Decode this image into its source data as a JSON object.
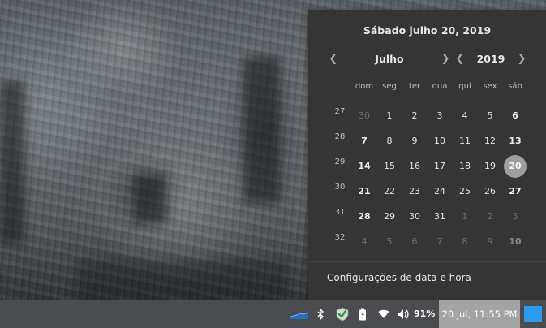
{
  "calendar": {
    "heading": "Sábado julho 20, 2019",
    "month_label": "Julho",
    "year_label": "2019",
    "weekdays": [
      "dom",
      "seg",
      "ter",
      "qua",
      "qui",
      "sex",
      "sáb"
    ],
    "week_numbers": [
      "27",
      "28",
      "29",
      "30",
      "31",
      "32"
    ],
    "weeks": [
      [
        "30",
        "1",
        "2",
        "3",
        "4",
        "5",
        "6"
      ],
      [
        "7",
        "8",
        "9",
        "10",
        "11",
        "12",
        "13"
      ],
      [
        "14",
        "15",
        "16",
        "17",
        "18",
        "19",
        "20"
      ],
      [
        "21",
        "22",
        "23",
        "24",
        "25",
        "26",
        "27"
      ],
      [
        "28",
        "29",
        "30",
        "31",
        "1",
        "2",
        "3"
      ],
      [
        "4",
        "5",
        "6",
        "7",
        "8",
        "9",
        "10"
      ]
    ],
    "selected_day": "20",
    "settings_label": "Configurações de data e hora"
  },
  "panel": {
    "battery_percent": "91%",
    "clock": "20 jul, 11:55 PM",
    "tray_icons": [
      "network-graph-icon",
      "bluetooth-icon",
      "security-shield-icon",
      "battery-icon",
      "wifi-icon",
      "volume-icon"
    ],
    "accent_color": "#2b9af3"
  }
}
